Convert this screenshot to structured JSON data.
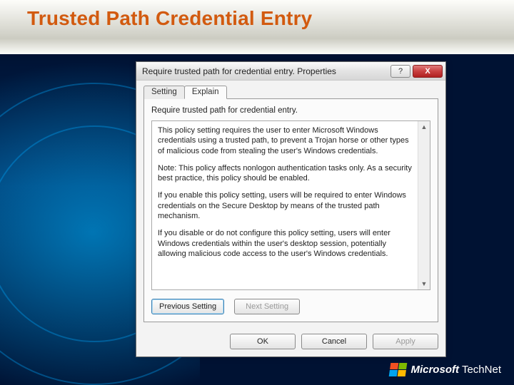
{
  "slide": {
    "title": "Trusted Path Credential Entry",
    "footer": {
      "brand": "Microsoft",
      "product": "TechNet"
    }
  },
  "dialog": {
    "title": "Require trusted path for credential entry. Properties",
    "help_btn": "?",
    "close_btn": "X",
    "tabs": {
      "setting": "Setting",
      "explain": "Explain"
    },
    "policy_name": "Require trusted path for credential entry.",
    "explain": {
      "p1": "This policy setting requires the user to enter Microsoft Windows credentials using a trusted path, to prevent a Trojan horse or other types of malicious code from stealing the user's Windows credentials.",
      "p2": "Note: This policy affects nonlogon authentication tasks only. As a security best practice, this policy should be enabled.",
      "p3": "If you enable this policy setting, users will be required to enter Windows credentials on the Secure Desktop by means of the trusted path mechanism.",
      "p4": "If you disable or do not configure this policy setting, users will enter Windows credentials within the user's desktop session, potentially allowing malicious code access to the user's Windows credentials."
    },
    "nav": {
      "prev": "Previous Setting",
      "next": "Next Setting"
    },
    "buttons": {
      "ok": "OK",
      "cancel": "Cancel",
      "apply": "Apply"
    }
  }
}
